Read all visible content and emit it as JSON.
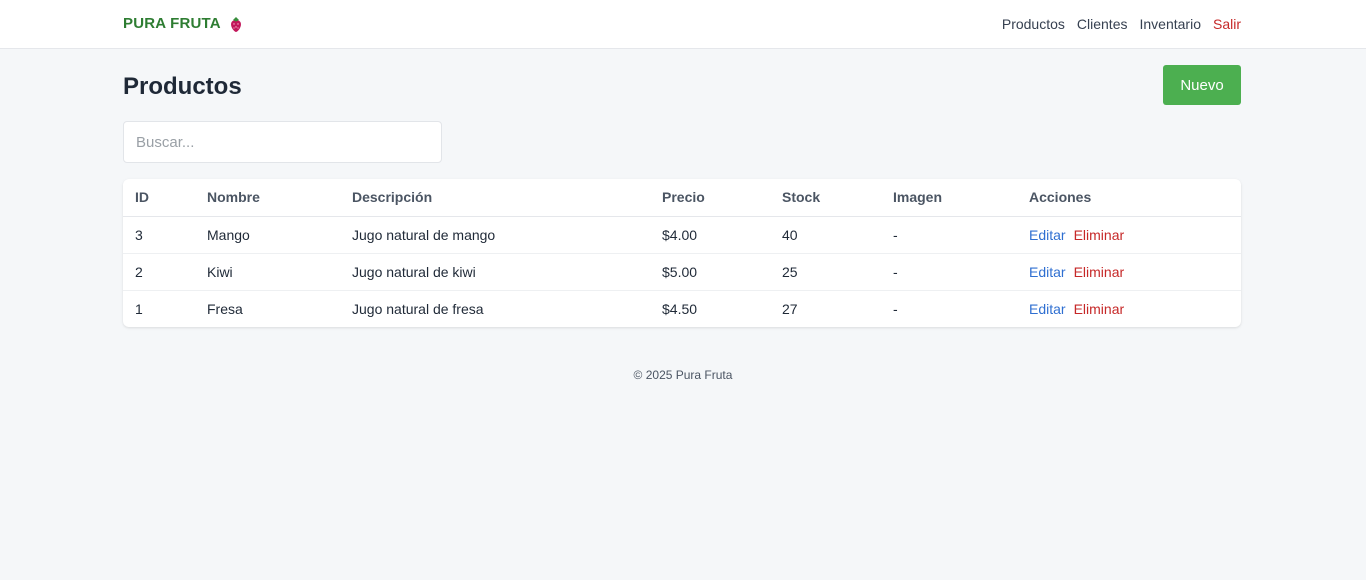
{
  "brand": {
    "name": "PURA FRUTA",
    "icon": "strawberry-icon"
  },
  "nav": {
    "items": [
      "Productos",
      "Clientes",
      "Inventario"
    ],
    "logout": "Salir"
  },
  "page": {
    "title": "Productos",
    "new_button": "Nuevo"
  },
  "search": {
    "placeholder": "Buscar...",
    "value": ""
  },
  "table": {
    "headers": [
      "ID",
      "Nombre",
      "Descripción",
      "Precio",
      "Stock",
      "Imagen",
      "Acciones"
    ],
    "rows": [
      {
        "id": "3",
        "name": "Mango",
        "description": "Jugo natural de mango",
        "price": "$4.00",
        "stock": "40",
        "image": "-"
      },
      {
        "id": "2",
        "name": "Kiwi",
        "description": "Jugo natural de kiwi",
        "price": "$5.00",
        "stock": "25",
        "image": "-"
      },
      {
        "id": "1",
        "name": "Fresa",
        "description": "Jugo natural de fresa",
        "price": "$4.50",
        "stock": "27",
        "image": "-"
      }
    ],
    "actions": {
      "edit": "Editar",
      "delete": "Eliminar"
    }
  },
  "footer": {
    "text": "© 2025 Pura Fruta"
  },
  "colors": {
    "brand": "#2e7d32",
    "primary_button": "#4caf50",
    "edit_link": "#2f6fd1",
    "danger": "#c62828",
    "background": "#f5f7f9"
  }
}
